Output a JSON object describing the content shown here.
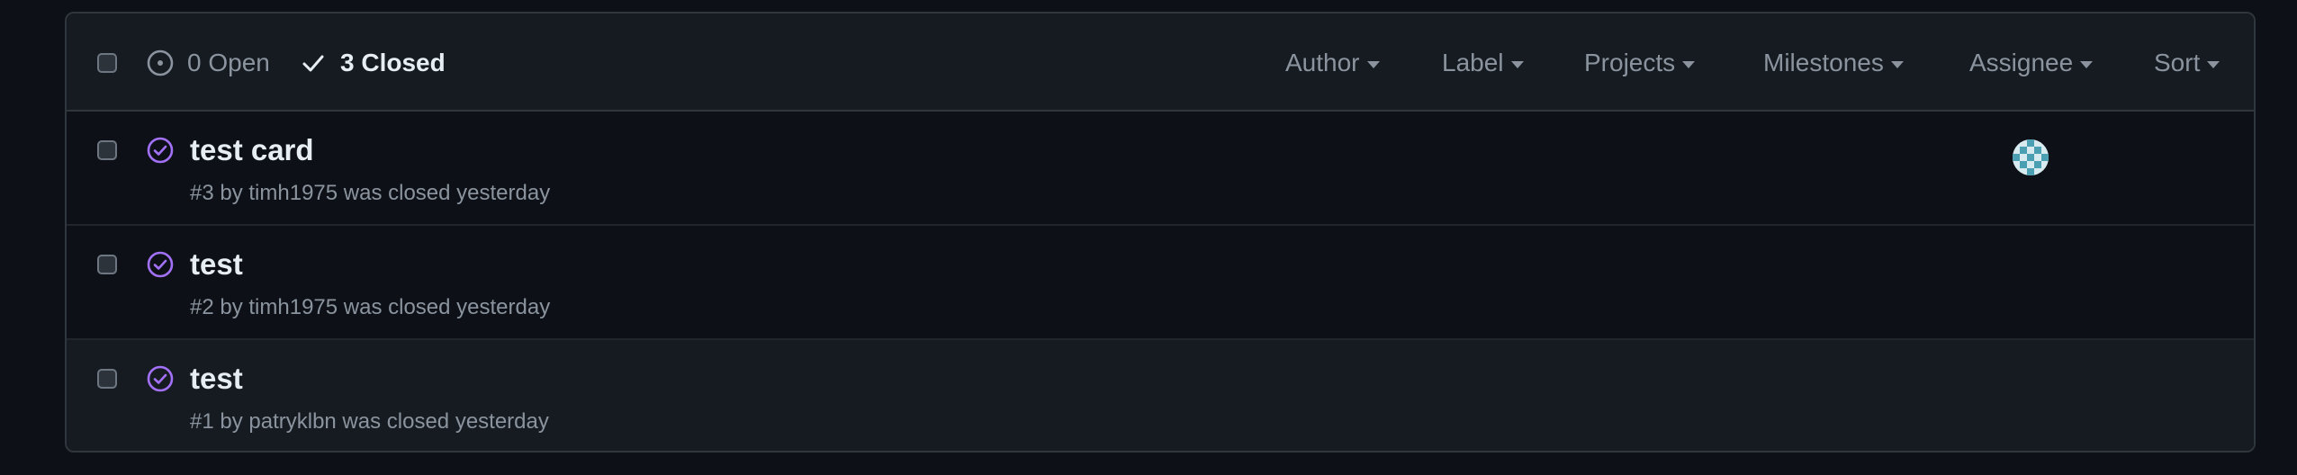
{
  "header": {
    "open_label": "0 Open",
    "closed_label": "3 Closed",
    "filters": [
      "Author",
      "Label",
      "Projects",
      "Milestones",
      "Assignee",
      "Sort"
    ]
  },
  "issues": [
    {
      "title": "test card",
      "meta": "#3 by timh1975 was closed yesterday",
      "has_assignee": true
    },
    {
      "title": "test",
      "meta": "#2 by timh1975 was closed yesterday",
      "has_assignee": false
    },
    {
      "title": "test",
      "meta": "#1 by patryklbn was closed yesterday",
      "has_assignee": false
    }
  ],
  "colors": {
    "background": "#0d1117",
    "header_background": "#161b22",
    "border": "#30363d",
    "closed_icon": "#a371f7",
    "muted_text": "#8b949e",
    "primary_text": "#e6edf3"
  },
  "icons": {
    "open_state": "issue-open-icon",
    "closed_state": "check-icon",
    "issue_status": "issue-closed-icon",
    "dropdown": "caret-down-icon"
  }
}
